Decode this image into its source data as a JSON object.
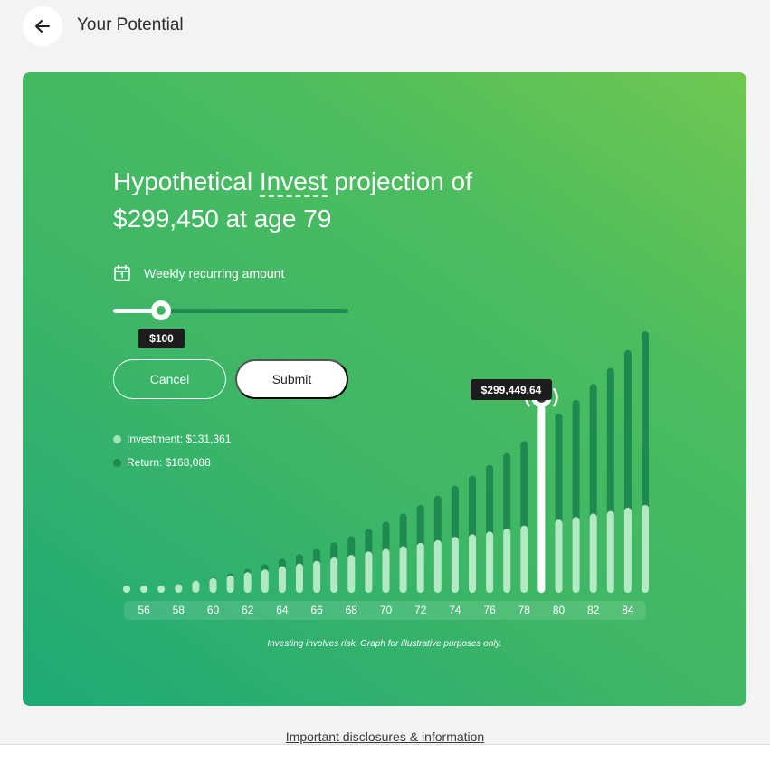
{
  "header": {
    "title": "Your Potential",
    "back_icon": "arrow-left-icon"
  },
  "projection": {
    "headline_prefix": "Hypothetical ",
    "headline_link": "Invest",
    "headline_mid": " projection of",
    "headline_line2": "$299,450 at age 79"
  },
  "recurring": {
    "label": "Weekly recurring amount",
    "icon": "calendar-icon",
    "value": "$100",
    "slider_fraction": 0.21
  },
  "buttons": {
    "cancel": "Cancel",
    "submit": "Submit"
  },
  "legend": {
    "investment": "Investment: $131,361",
    "return": "Return: $168,088",
    "investment_color": "#9fe3b6",
    "return_color": "#1f8a4f"
  },
  "tooltip": {
    "value": "$299,449.64"
  },
  "disclaimer": "Investing involves risk. Graph for illustrative purposes only.",
  "footer": {
    "disclosures_link": "Important disclosures & information"
  },
  "chart_data": {
    "type": "bar",
    "stacked": true,
    "x": [
      55,
      56,
      57,
      58,
      59,
      60,
      61,
      62,
      63,
      64,
      65,
      66,
      67,
      68,
      69,
      70,
      71,
      72,
      73,
      74,
      75,
      76,
      77,
      78,
      79,
      80,
      81,
      82,
      83,
      84,
      85
    ],
    "tick_labels": [
      "56",
      "58",
      "60",
      "62",
      "64",
      "66",
      "68",
      "70",
      "72",
      "74",
      "76",
      "78",
      "80",
      "82",
      "84"
    ],
    "series": [
      {
        "name": "Investment",
        "values": [
          0,
          4,
          9,
          13,
          18,
          22,
          26,
          31,
          35,
          40,
          44,
          48,
          53,
          57,
          62,
          66,
          70,
          75,
          79,
          84,
          88,
          92,
          97,
          101,
          131,
          110,
          114,
          119,
          123,
          128,
          132
        ]
      },
      {
        "name": "Return",
        "values": [
          0,
          0,
          0,
          0,
          0,
          1,
          3,
          5,
          8,
          11,
          14,
          18,
          23,
          28,
          34,
          41,
          49,
          57,
          67,
          77,
          88,
          100,
          113,
          127,
          168,
          159,
          176,
          195,
          215,
          237,
          261
        ]
      }
    ],
    "selected_x": 79,
    "selected_total": 299449.64,
    "ylim": [
      0,
      400
    ]
  },
  "colors": {
    "selected_bar": "#ffffff",
    "tooltip_bg": "#1d1d1d"
  }
}
